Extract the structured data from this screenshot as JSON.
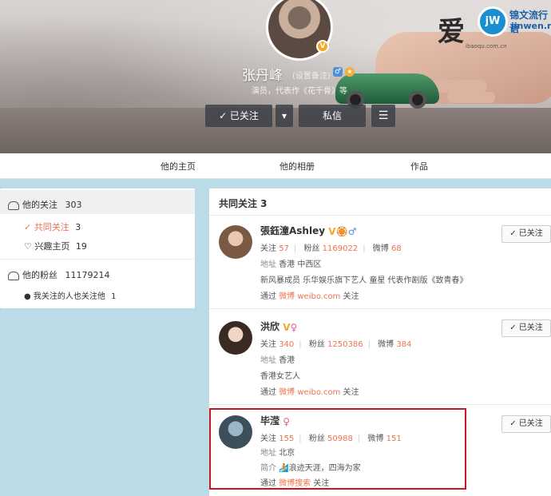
{
  "profile": {
    "name": "张丹峰",
    "remark": "(设置备注)",
    "bio": "演员，代表作《花千骨》等",
    "follow_label": "✓ 已关注",
    "message_label": "私信",
    "menu_icon": "menu-icon",
    "dropdown_icon": "chevron-down-icon"
  },
  "logo": {
    "big_char": "爱",
    "circle_text": "jW",
    "cn": "锦文流行语",
    "en": "jinwen.net",
    "tiny": "ibaoqu.com.cn"
  },
  "tabs": [
    "他的主页",
    "他的相册",
    "作品"
  ],
  "left": {
    "following_label": "他的关注",
    "following_count": "303",
    "common_label": "共同关注",
    "common_count": "3",
    "interest_label": "兴趣主页",
    "interest_count": "19",
    "fans_label": "他的粉丝",
    "fans_count": "11179214",
    "fans_sub_label": "我关注的人也关注他",
    "fans_sub_count": "1"
  },
  "right": {
    "title": "共同关注 3",
    "items": [
      {
        "name": "張鈺潼Ashley",
        "follow": "57",
        "fans": "1169022",
        "weibo": "68",
        "addr": "香港 中西区",
        "desc": "新风暴成员 乐华娱乐旗下艺人 童星 代表作剧版《致青春》",
        "via_source": "微博 weibo.com",
        "btn": "✓ 已关注"
      },
      {
        "name": "洪欣",
        "follow": "340",
        "fans": "1250386",
        "weibo": "384",
        "addr": "香港",
        "desc": "香港女艺人",
        "via_source": "微博 weibo.com",
        "btn": "✓ 已关注"
      },
      {
        "name": "毕滢",
        "follow": "155",
        "fans": "50988",
        "weibo": "151",
        "addr": "北京",
        "intro_label": "简介",
        "desc": "🏄浪迹天涯，四海为家",
        "via_source": "微博搜索",
        "btn": "✓ 已关注"
      }
    ],
    "labels": {
      "follow": "关注",
      "fans": "粉丝",
      "weibo": "微博",
      "addr": "地址",
      "via": "通过",
      "via_suffix": "关注"
    }
  },
  "colors": {
    "accent": "#eb7350",
    "highlight": "#d0141e"
  }
}
